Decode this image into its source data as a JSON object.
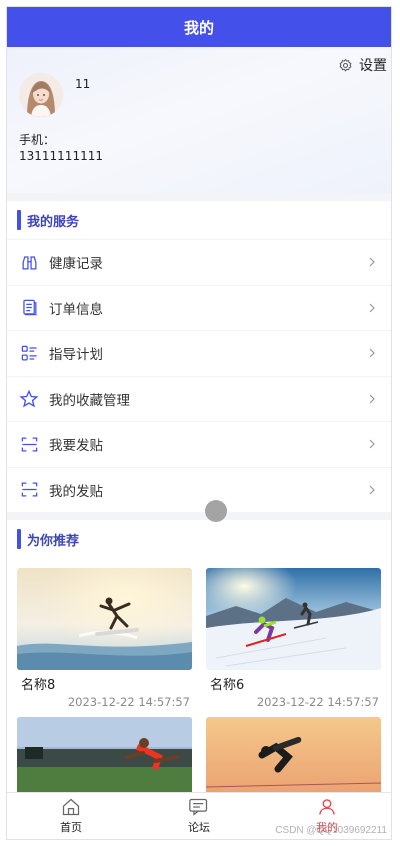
{
  "header": {
    "title": "我的"
  },
  "profile": {
    "settings_label": "设置",
    "username": "11",
    "phone_label": "手机：",
    "phone_value": "13111111111"
  },
  "services": {
    "title": "我的服务",
    "items": [
      {
        "label": "健康记录",
        "icon": "binoculars-icon"
      },
      {
        "label": "订单信息",
        "icon": "document-icon"
      },
      {
        "label": "指导计划",
        "icon": "list-icon"
      },
      {
        "label": "我的收藏管理",
        "icon": "star-icon"
      },
      {
        "label": "我要发贴",
        "icon": "scan-icon"
      },
      {
        "label": "我的发贴",
        "icon": "scan-icon"
      }
    ]
  },
  "recommend": {
    "title": "为你推荐",
    "cards": [
      {
        "name": "名称8",
        "date": "2023-12-22 14:57:57"
      },
      {
        "name": "名称6",
        "date": "2023-12-22 14:57:57"
      },
      {
        "name": "",
        "date": ""
      },
      {
        "name": "",
        "date": ""
      }
    ]
  },
  "tabbar": {
    "items": [
      {
        "label": "首页",
        "icon": "home-icon"
      },
      {
        "label": "论坛",
        "icon": "chat-icon"
      },
      {
        "label": "我的",
        "icon": "user-icon"
      }
    ],
    "active_index": 2
  },
  "watermark": "CSDN @QQ1039692211",
  "colors": {
    "accent": "#4351ea",
    "active_tab": "#e8424e",
    "section_title": "#3d45b8"
  }
}
